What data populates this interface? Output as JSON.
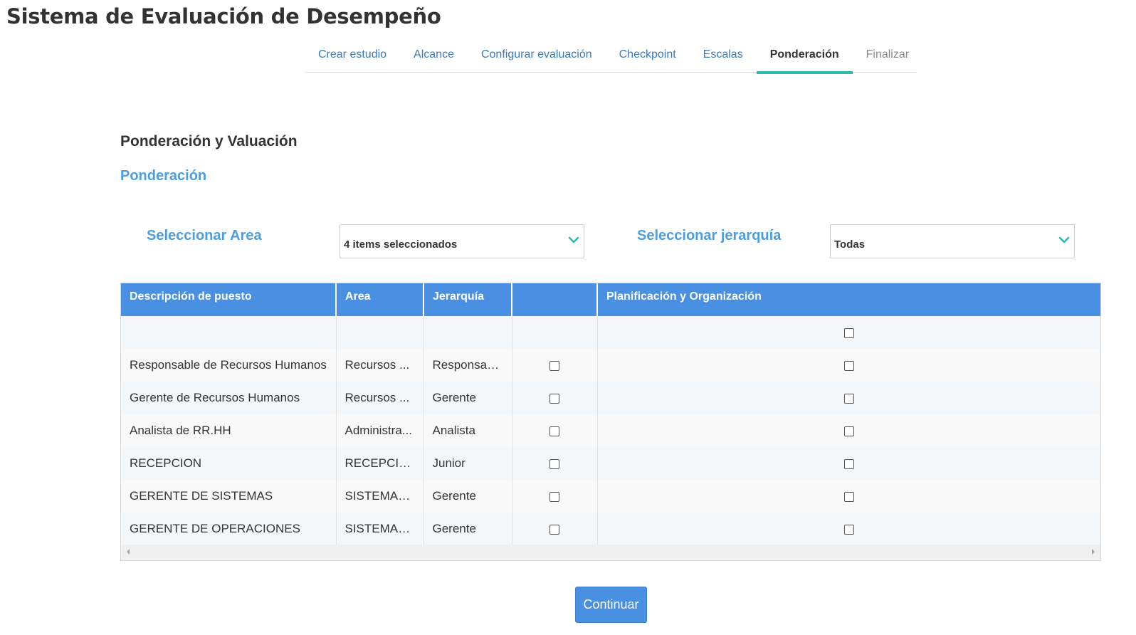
{
  "app": {
    "title": "Sistema de Evaluación de Desempeño"
  },
  "tabs": [
    {
      "label": "Crear estudio",
      "state": "link"
    },
    {
      "label": "Alcance",
      "state": "link"
    },
    {
      "label": "Configurar evaluación",
      "state": "link"
    },
    {
      "label": "Checkpoint",
      "state": "link"
    },
    {
      "label": "Escalas",
      "state": "link"
    },
    {
      "label": "Ponderación",
      "state": "active"
    },
    {
      "label": "Finalizar",
      "state": "disabled"
    }
  ],
  "section": {
    "title": "Ponderación y Valuación",
    "subtitle": "Ponderación"
  },
  "filters": {
    "area": {
      "label": "Seleccionar Area",
      "value": "4 items seleccionados"
    },
    "jerarquia": {
      "label": "Seleccionar jerarquía",
      "value": "Todas"
    }
  },
  "table": {
    "columns": [
      "Descripción de puesto",
      "Area",
      "Jerarquía",
      "",
      "Planificación y Organización"
    ],
    "rows": [
      {
        "puesto": "",
        "area": "",
        "jerarquia": "",
        "select": null,
        "planificacion": false
      },
      {
        "puesto": "Responsable de Recursos Humanos",
        "area": "Recursos ...",
        "jerarquia": "Responsable",
        "select": false,
        "planificacion": false
      },
      {
        "puesto": "Gerente de Recursos Humanos",
        "area": "Recursos ...",
        "jerarquia": "Gerente",
        "select": false,
        "planificacion": false
      },
      {
        "puesto": "Analista de RR.HH",
        "area": "Administra...",
        "jerarquia": "Analista",
        "select": false,
        "planificacion": false
      },
      {
        "puesto": "RECEPCION",
        "area": "RECEPCION",
        "jerarquia": "Junior",
        "select": false,
        "planificacion": false
      },
      {
        "puesto": "GERENTE DE SISTEMAS",
        "area": "SISTEMAS...",
        "jerarquia": "Gerente",
        "select": false,
        "planificacion": false
      },
      {
        "puesto": "GERENTE DE OPERACIONES",
        "area": "SISTEMAS...",
        "jerarquia": "Gerente",
        "select": false,
        "planificacion": false
      }
    ]
  },
  "actions": {
    "continue_label": "Continuar"
  },
  "colors": {
    "accent": "#4a90e2",
    "tab_indicator": "#2bbbad",
    "label_blue": "#4a9ee0"
  },
  "icons": {
    "select_chevron": "chevron-down-icon"
  }
}
